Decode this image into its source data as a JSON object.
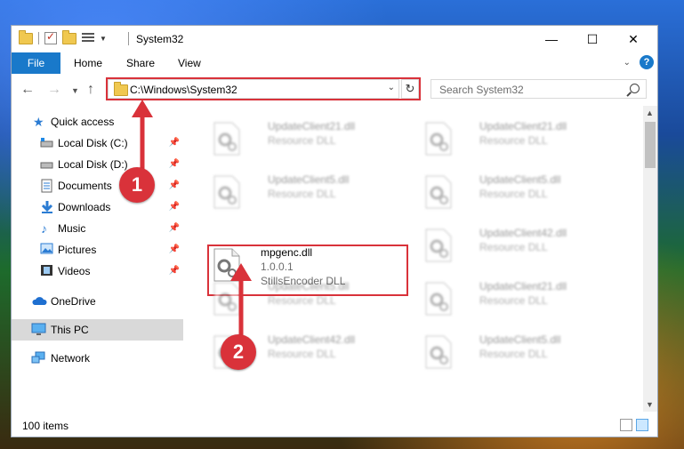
{
  "window": {
    "title": "System32",
    "controls": {
      "minimize": "—",
      "maximize": "☐",
      "close": "✕"
    }
  },
  "ribbon": {
    "file_tab": "File",
    "tabs": [
      "Home",
      "Share",
      "View"
    ],
    "help_icon": "?"
  },
  "address": {
    "path": "C:\\Windows\\System32",
    "search_placeholder": "Search System32"
  },
  "nav": {
    "items": [
      {
        "label": "Quick access",
        "icon": "star-icon"
      },
      {
        "label": "Local Disk (C:)",
        "icon": "drive-icon",
        "pinned": true
      },
      {
        "label": "Local Disk (D:)",
        "icon": "drive-icon",
        "pinned": true
      },
      {
        "label": "Documents",
        "icon": "documents-icon",
        "pinned": true
      },
      {
        "label": "Downloads",
        "icon": "downloads-icon",
        "pinned": true
      },
      {
        "label": "Music",
        "icon": "music-icon",
        "pinned": true
      },
      {
        "label": "Pictures",
        "icon": "pictures-icon",
        "pinned": true
      },
      {
        "label": "Videos",
        "icon": "videos-icon",
        "pinned": true
      },
      {
        "label": "OneDrive",
        "icon": "cloud-icon"
      },
      {
        "label": "This PC",
        "icon": "computer-icon",
        "selected": true
      },
      {
        "label": "Network",
        "icon": "network-icon"
      }
    ]
  },
  "files": [
    {
      "name": "UpdateClient21.dll",
      "line1": "Resource DLL",
      "line2": "",
      "blurred": true
    },
    {
      "name": "UpdateClient21.dll",
      "line1": "Resource DLL",
      "line2": "",
      "blurred": true
    },
    {
      "name": "UpdateClient5.dll",
      "line1": "Resource DLL",
      "line2": "",
      "blurred": true
    },
    {
      "name": "UpdateClient5.dll",
      "line1": "Resource DLL",
      "line2": "",
      "blurred": true
    },
    {
      "name": "mpgenc.dll",
      "line1": "1.0.0.1",
      "line2": "StillsEncoder DLL",
      "blurred": false
    },
    {
      "name": "UpdateClient42.dll",
      "line1": "Resource DLL",
      "line2": "",
      "blurred": true
    },
    {
      "name": "UpdateClient5.dll",
      "line1": "Resource DLL",
      "line2": "",
      "blurred": true
    },
    {
      "name": "UpdateClient21.dll",
      "line1": "Resource DLL",
      "line2": "",
      "blurred": true
    },
    {
      "name": "UpdateClient42.dll",
      "line1": "Resource DLL",
      "line2": "",
      "blurred": true
    },
    {
      "name": "UpdateClient5.dll",
      "line1": "Resource DLL",
      "line2": "",
      "blurred": true
    }
  ],
  "status": {
    "item_count": "100 items"
  },
  "callouts": {
    "step1": "1",
    "step2": "2",
    "color": "#d9323a"
  }
}
